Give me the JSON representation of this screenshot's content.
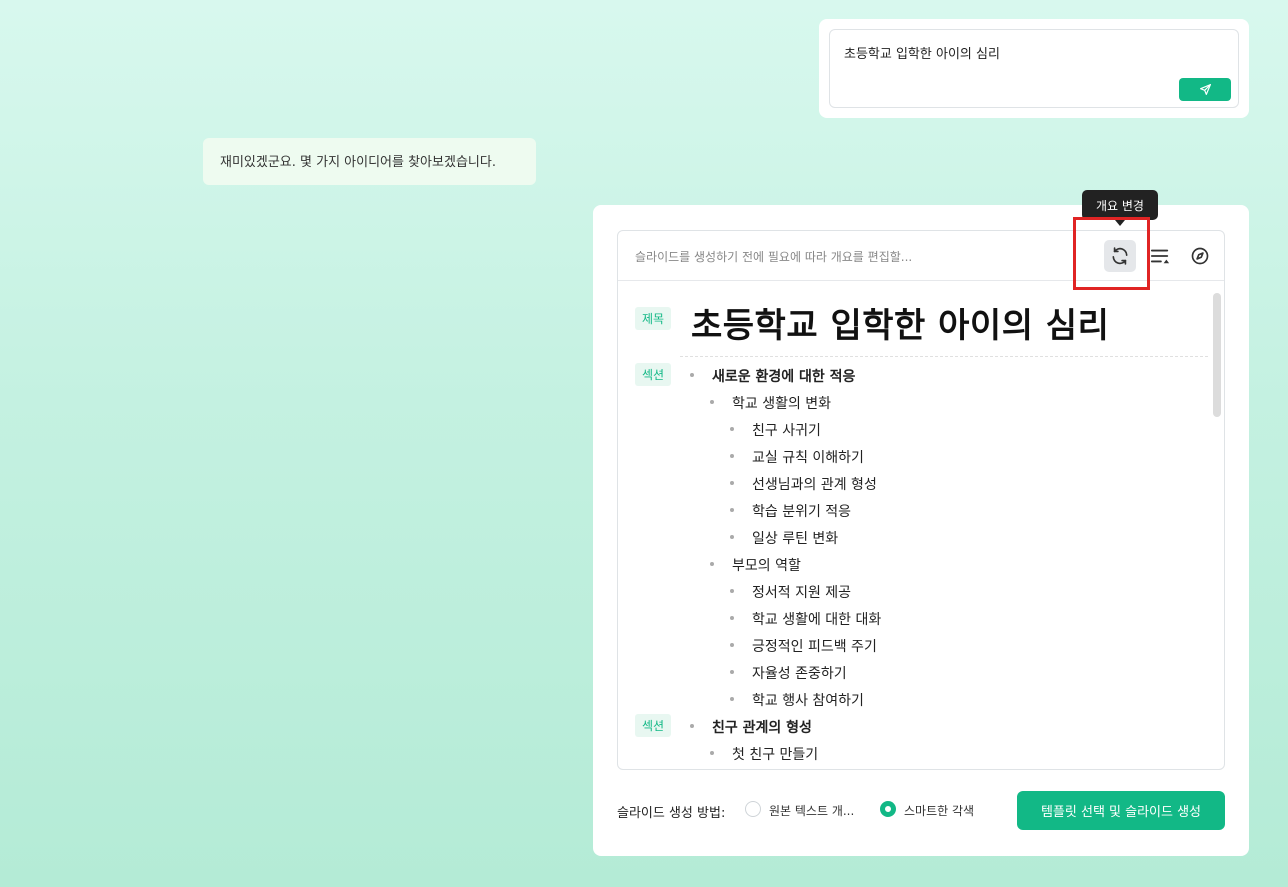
{
  "prompt": {
    "text": "초등학교 입학한 아이의 심리",
    "send_icon": "send-icon"
  },
  "assistant_message": "재미있겠군요. 몇 가지 아이디어를 찾아보겠습니다.",
  "editor": {
    "hint": "슬라이드를 생성하기 전에 필요에 따라 개요를 편집할...",
    "tooltip": "개요 변경",
    "title_tag": "제목",
    "title": "초등학교 입학한 아이의 심리",
    "section_tag": "섹션",
    "rows": [
      {
        "level": 1,
        "text": "새로운 환경에 대한 적응",
        "tag": "섹션"
      },
      {
        "level": 2,
        "text": "학교 생활의 변화"
      },
      {
        "level": 3,
        "text": "친구 사귀기"
      },
      {
        "level": 3,
        "text": "교실 규칙 이해하기"
      },
      {
        "level": 3,
        "text": "선생님과의 관계 형성"
      },
      {
        "level": 3,
        "text": "학습 분위기 적응"
      },
      {
        "level": 3,
        "text": "일상 루틴 변화"
      },
      {
        "level": 2,
        "text": "부모의 역할"
      },
      {
        "level": 3,
        "text": "정서적 지원 제공"
      },
      {
        "level": 3,
        "text": "학교 생활에 대한 대화"
      },
      {
        "level": 3,
        "text": "긍정적인 피드백 주기"
      },
      {
        "level": 3,
        "text": "자율성 존중하기"
      },
      {
        "level": 3,
        "text": "학교 행사 참여하기"
      },
      {
        "level": 1,
        "text": "친구 관계의 형성",
        "tag": "섹션"
      },
      {
        "level": 2,
        "text": "첫 친구 만들기"
      }
    ]
  },
  "footer": {
    "method_label": "슬라이드 생성 방법:",
    "option_original": "원본 텍스트 개...",
    "option_smart": "스마트한 각색",
    "selected": "스마트한 각색",
    "generate_label": "템플릿 선택 및 슬라이드 생성"
  },
  "colors": {
    "accent": "#12b886",
    "highlight": "#e02424"
  }
}
